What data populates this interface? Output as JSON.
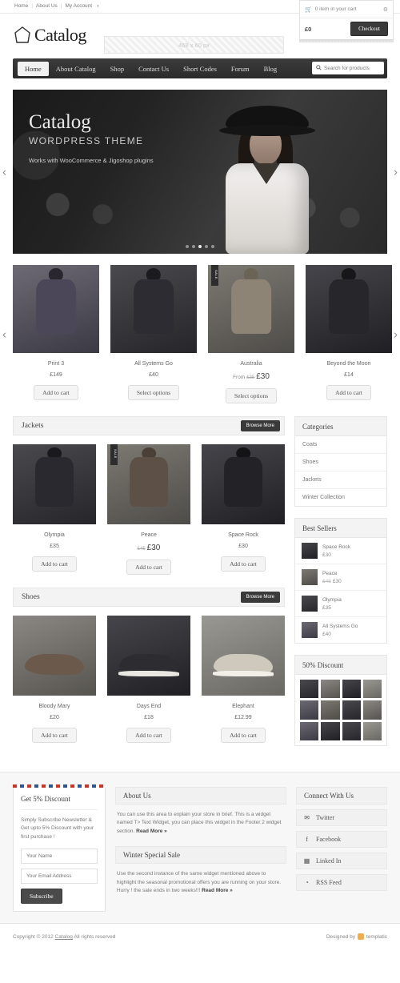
{
  "topbar": {
    "links": [
      "Home",
      "About Us",
      "My Account"
    ],
    "caret": "▾"
  },
  "cart": {
    "icon": "🛒",
    "text": "0 item in your cart",
    "gear_icon": "⚙",
    "total": "£0",
    "checkout_label": "Checkout"
  },
  "brand": {
    "name": "Catalog"
  },
  "ad": {
    "placeholder_text": "468 x 60 px"
  },
  "nav": {
    "items": [
      "Home",
      "About Catalog",
      "Shop",
      "Contact Us",
      "Short Codes",
      "Forum",
      "Blog"
    ],
    "active": "Home",
    "search_placeholder": "Search for products",
    "search_value": "",
    "search_icon": "🔍"
  },
  "hero": {
    "title": "Catalog",
    "subtitle": "WORDPRESS THEME",
    "description": "Works with WooCommerce & Jigoshop plugins",
    "dots": 5,
    "active_dot": 2,
    "prev_icon": "‹",
    "next_icon": "›"
  },
  "featured": {
    "prev_icon": "‹",
    "next_icon": "›",
    "products": [
      {
        "name": "Print 3",
        "price": "£149",
        "button": "Add to cart",
        "sale": false,
        "style": "pi-bg1"
      },
      {
        "name": "All Systems Go",
        "price": "£40",
        "button": "Select options",
        "sale": false,
        "style": "pi-bg2"
      },
      {
        "name": "Australia",
        "price_from": "From",
        "price_old": "£35",
        "price": "£30",
        "button": "Select options",
        "sale": true,
        "sale_label": "SALE",
        "style": "pi-bg3"
      },
      {
        "name": "Beyond the Moon",
        "price": "£14",
        "button": "Add to cart",
        "sale": false,
        "style": "pi-bg4"
      }
    ]
  },
  "sections": [
    {
      "title": "Jackets",
      "browse_label": "Browse More",
      "products": [
        {
          "name": "Olympia",
          "price": "£35",
          "button": "Add to cart",
          "sale": false,
          "style": "pi-bg2"
        },
        {
          "name": "Peace",
          "price_old": "£45",
          "price": "£30",
          "button": "Add to cart",
          "sale": true,
          "sale_label": "SALE",
          "style": "pi-bg3"
        },
        {
          "name": "Space Rock",
          "price": "£30",
          "button": "Add to cart",
          "sale": false,
          "style": "pi-bg4"
        }
      ]
    },
    {
      "title": "Shoes",
      "browse_label": "Browse More",
      "products": [
        {
          "name": "Bloody Mary",
          "price": "£20",
          "button": "Add to cart",
          "sale": false,
          "style": "pi-bg5",
          "shoe": true
        },
        {
          "name": "Days End",
          "price": "£18",
          "button": "Add to cart",
          "sale": false,
          "style": "pi-bg4",
          "shoe": true
        },
        {
          "name": "Elephant",
          "price": "£12.99",
          "button": "Add to cart",
          "sale": false,
          "style": "pi-bg6",
          "shoe": true
        }
      ]
    }
  ],
  "sidebar": {
    "categories": {
      "title": "Categories",
      "items": [
        "Coats",
        "Shoes",
        "Jackets",
        "Winter Collection"
      ]
    },
    "best_sellers": {
      "title": "Best Sellers",
      "items": [
        {
          "name": "Space Rock",
          "price": "£30",
          "style": "pi-bg4"
        },
        {
          "name": "Peace",
          "price_old": "£45",
          "price": "£30",
          "style": "pi-bg3"
        },
        {
          "name": "Olympia",
          "price": "£35",
          "style": "pi-bg2"
        },
        {
          "name": "All Systems Go",
          "price": "£40",
          "style": "pi-bg1"
        }
      ]
    },
    "discount": {
      "title": "50% Discount",
      "thumbs": [
        "pi-bg2",
        "pi-bg5",
        "pi-bg4",
        "pi-bg6",
        "pi-bg1",
        "pi-bg3",
        "pi-bg2",
        "pi-bg5",
        "pi-bg1",
        "pi-bg4",
        "pi-bg2",
        "pi-bg6"
      ]
    }
  },
  "footer": {
    "newsletter": {
      "title": "Get 5% Discount",
      "description": "Simply Subscribe Newsletter & Get upto 5% Discount with your first purchase !",
      "name_placeholder": "Your Name",
      "name_value": "",
      "email_placeholder": "Your Email Address",
      "email_value": "",
      "button": "Subscribe"
    },
    "widgets": [
      {
        "title": "About Us",
        "body": "You can use this area to explain your store in brief. This is a widget named T> Text Widget, you can place this widget in the Footer 2 widget section.",
        "read_more": "Read More »"
      },
      {
        "title": "Winter Special Sale",
        "body": "Use the second instance of the same widget mentioned above to highlight the seasonal promotional offers you are running on your store. Hurry ! the sale ends in two weeks!!!",
        "read_more": "Read More »"
      }
    ],
    "social": {
      "title": "Connect With Us",
      "items": [
        {
          "label": "Twitter",
          "icon": "✉"
        },
        {
          "label": "Facebook",
          "icon": "f"
        },
        {
          "label": "Linked In",
          "icon": "▦"
        },
        {
          "label": "RSS Feed",
          "icon": "◔"
        }
      ]
    }
  },
  "copyright": {
    "prefix": "Copyright © 2012",
    "link": "Catalog",
    "suffix": "All rights reserved",
    "designed_by": "Designed by",
    "vendor": "templatic"
  }
}
